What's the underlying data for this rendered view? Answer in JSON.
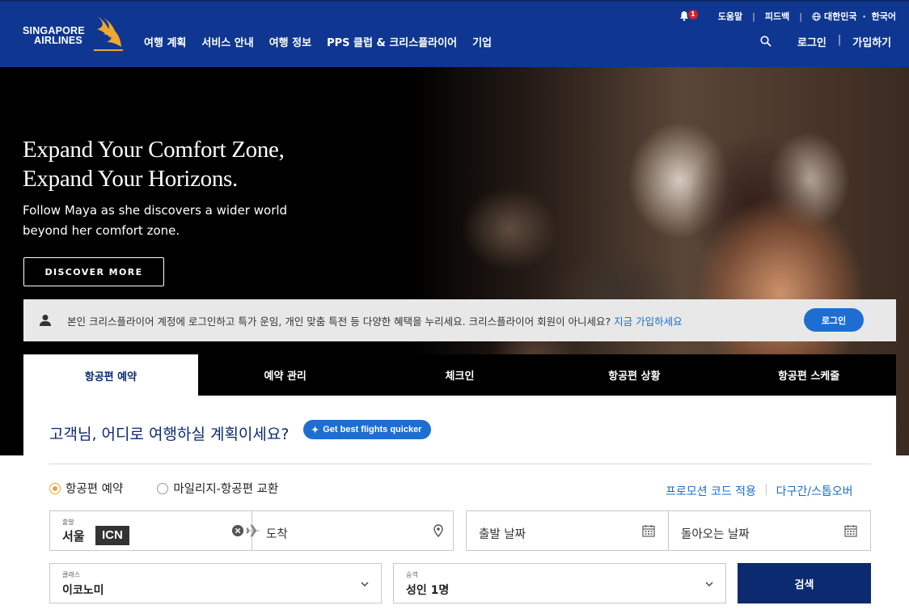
{
  "brand": {
    "line1": "SINGAPORE",
    "line2": "AIRLINES",
    "accent": "#f0a830",
    "header_bg": "#0f3791"
  },
  "nav": {
    "items": [
      "여행 계획",
      "서비스 안내",
      "여행 정보",
      "PPS 클럽 & 크리스플라이어",
      "기업"
    ]
  },
  "utility": {
    "notification_count": "1",
    "help": "도움말",
    "feedback": "피드백",
    "region": "대한민국",
    "separator_dot": "·",
    "language": "한국어"
  },
  "auth": {
    "login": "로그인",
    "signup": "가입하기"
  },
  "hero": {
    "title_line1": "Expand Your Comfort Zone,",
    "title_line2": "Expand Your Horizons.",
    "subtitle_line1": "Follow Maya as she discovers a wider world",
    "subtitle_line2": "beyond her comfort zone.",
    "cta": "DISCOVER MORE"
  },
  "login_banner": {
    "text": "본인 크리스플라이어 계정에 로그인하고 특가 운임, 개인 맞춤 특전 등 다양한 혜택을 누리세요. 크리스플라이어 회원이 아니세요?",
    "link": "지금 가입하세요",
    "button": "로그인"
  },
  "tabs": [
    "항공편 예약",
    "예약 관리",
    "체크인",
    "항공편 상황",
    "항공편 스케줄"
  ],
  "booking": {
    "question": "고객님, 어디로 여행하실 계획이세요?",
    "ai_pill": "Get best flights quicker",
    "radio_options": [
      "항공편 예약",
      "마일리지-항공편 교환"
    ],
    "promo_link": "프로모션 코드 적용",
    "multicity_link": "다구간/스톱오버",
    "from": {
      "caption": "출발",
      "city": "서울",
      "code": "ICN"
    },
    "to": {
      "placeholder": "도착"
    },
    "depart": {
      "placeholder": "출발 날짜"
    },
    "return": {
      "placeholder": "돌아오는 날짜"
    },
    "cabin": {
      "caption": "클래스",
      "value": "이코노미"
    },
    "passengers": {
      "caption": "승객",
      "value": "성인 1명"
    },
    "search": "검색"
  }
}
